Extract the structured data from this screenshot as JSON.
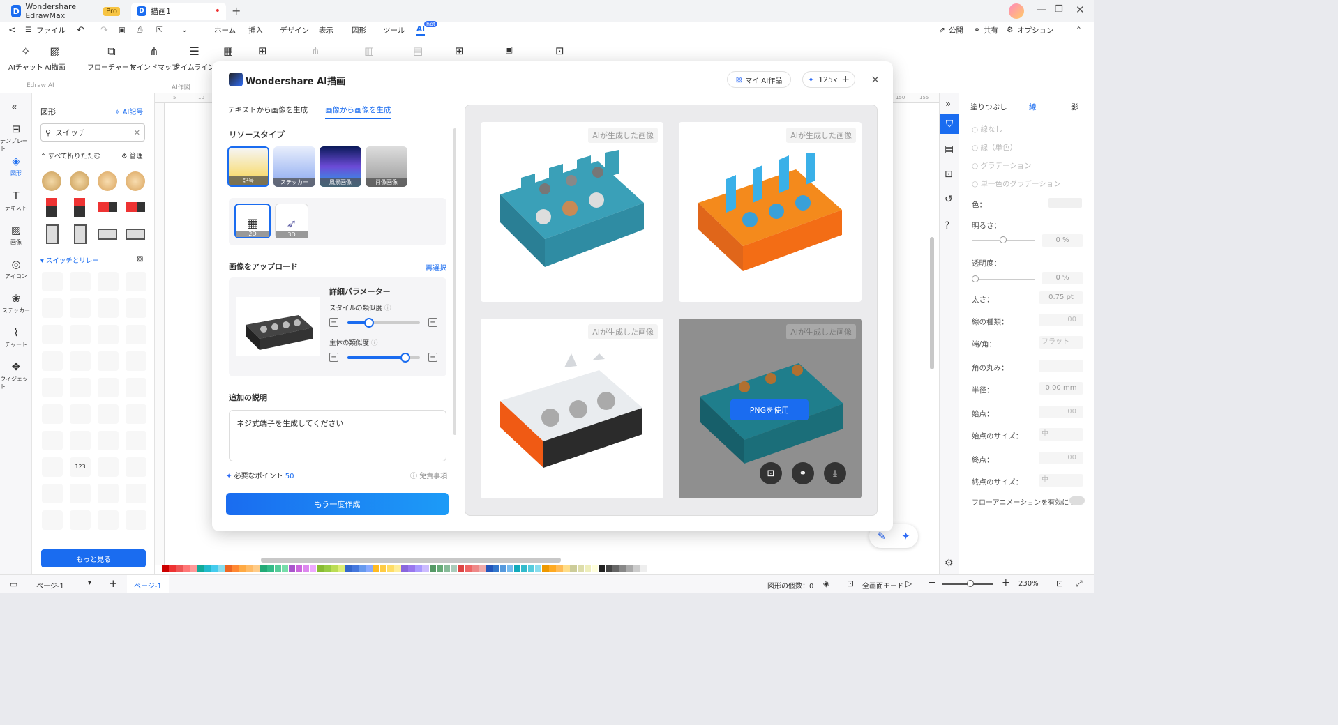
{
  "app": {
    "name": "Wondershare EdrawMax",
    "pro_badge": "Pro",
    "doc_tab": "描画1"
  },
  "menu": {
    "back": "<",
    "file": "ファイル",
    "items": [
      "ホーム",
      "挿入",
      "デザイン",
      "表示",
      "図形",
      "ツール",
      "AI"
    ],
    "ai_hot": "hot",
    "publish": "公開",
    "share": "共有",
    "options": "オプション"
  },
  "ribbon": {
    "buttons": [
      "AIチャット",
      "AI描画",
      "フローチャート",
      "マインドマップ",
      "タイムライン"
    ],
    "groups": [
      "Edraw AI",
      "AI作図"
    ]
  },
  "leftbar": [
    "テンプレート",
    "図形",
    "テキスト",
    "画像",
    "アイコン",
    "ステッカー",
    "チャート",
    "ウィジェット"
  ],
  "shapes_panel": {
    "title": "図形",
    "ai_symbol": "AI記号",
    "search_value": "スイッチ",
    "collapse_all": "すべて折りたたむ",
    "manage": "管理",
    "category": "スイッチとリレー",
    "more": "もっと見る",
    "sample_label": "123"
  },
  "ruler": {
    "top": [
      "5",
      "10"
    ],
    "top_right": [
      "150",
      "155"
    ],
    "left": [
      "50",
      "55",
      "60",
      "65",
      "70",
      "75",
      "80",
      "85",
      "90",
      "95",
      "100",
      "105",
      "110",
      "115",
      "120",
      "125"
    ]
  },
  "dialog": {
    "title": "Wondershare AI描画",
    "my_works": "マイ AI作品",
    "credits": "125k",
    "close": "×",
    "tabs": [
      "テキストから画像を生成",
      "画像から画像を生成"
    ],
    "resource_type": "リソースタイプ",
    "resources": [
      "記号",
      "ステッカー",
      "風景画像",
      "肖像画像"
    ],
    "dims": [
      "2D",
      "3D"
    ],
    "upload": "画像をアップロード",
    "reselect": "再選択",
    "params_title": "詳細パラメーター",
    "style_sim": "スタイルの類似度",
    "subject_sim": "主体の類似度",
    "style_sim_value": 0.3,
    "subject_sim_value": 0.8,
    "extra": "追加の説明",
    "prompt": "ネジ式端子を生成してください",
    "points_label": "必要なポイント",
    "points": "50",
    "disclaimer": "免責事項",
    "regenerate": "もう一度作成",
    "result_badge": "AIが生成した画像",
    "use_png": "PNGを使用"
  },
  "right_panel": {
    "tabs": [
      "塗りつぶし",
      "線",
      "影"
    ],
    "options": [
      "線なし",
      "線（単色）",
      "グラデーション",
      "単一色のグラデーション"
    ],
    "labels": {
      "color": "色：",
      "brightness": "明るさ：",
      "transparency": "透明度：",
      "width": "太さ：",
      "line_type": "線の種類：",
      "end": "端/角：",
      "round": "角の丸み：",
      "radius": "半径：",
      "start": "始点：",
      "start_size": "始点のサイズ：",
      "endpoint": "終点：",
      "end_size": "終点のサイズ：",
      "flow": "フローアニメーションを有効にする"
    },
    "values": {
      "brightness": "0 %",
      "transparency": "0 %",
      "width": "0.75 pt",
      "line_type": "00",
      "end": "フラット",
      "radius": "0.00 mm",
      "start": "00",
      "start_size": "中",
      "endpoint": "00",
      "end_size": "中"
    }
  },
  "status": {
    "page_selector": "ページ-1",
    "page_tab": "ページ-1",
    "shape_count": "図形の個数：0",
    "fullscreen": "全画面モード",
    "zoom": "230%"
  },
  "colors": {
    "accent": "#1a6cf0",
    "ai_blue": "#2f6cf6"
  }
}
